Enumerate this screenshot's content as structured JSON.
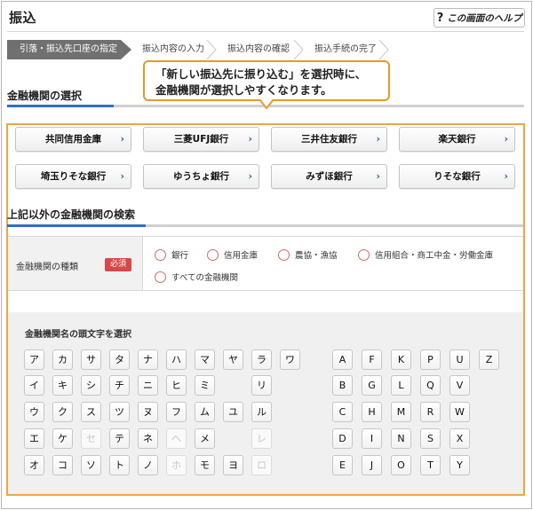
{
  "header": {
    "title": "振込",
    "help_label": "この画面のヘルプ",
    "help_icon": "?"
  },
  "steps": [
    {
      "label": "引落・振込先口座の指定",
      "active": true
    },
    {
      "label": "振込内容の入力",
      "active": false
    },
    {
      "label": "振込内容の確認",
      "active": false
    },
    {
      "label": "振込手続の完了",
      "active": false
    }
  ],
  "tooltip": {
    "line1": "「新しい振込先に振り込む」を選択時に、",
    "line2": "金融機関が選択しやすくなります。"
  },
  "section1": {
    "title": "金融機関の選択"
  },
  "banks": [
    "共同信用金庫",
    "三菱UFJ銀行",
    "三井住友銀行",
    "楽天銀行",
    "埼玉りそな銀行",
    "ゆうちょ銀行",
    "みずほ銀行",
    "りそな銀行"
  ],
  "bank_chevron": "›",
  "section2": {
    "title": "上記以外の金融機関の検索"
  },
  "institution_type": {
    "label": "金融機関の種類",
    "required_badge": "必須",
    "options": [
      "銀行",
      "信用金庫",
      "農協・漁協",
      "信用組合・商工中金・労働金庫",
      "すべての金融機関"
    ]
  },
  "kana_section": {
    "title": "金融機関名の頭文字を選択"
  },
  "kana_columns": [
    [
      "ア",
      "イ",
      "ウ",
      "エ",
      "オ"
    ],
    [
      "カ",
      "キ",
      "ク",
      "ケ",
      "コ"
    ],
    [
      "サ",
      "シ",
      "ス",
      "セ",
      "ソ"
    ],
    [
      "タ",
      "チ",
      "ツ",
      "テ",
      "ト"
    ],
    [
      "ナ",
      "ニ",
      "ヌ",
      "ネ",
      "ノ"
    ],
    [
      "ハ",
      "ヒ",
      "フ",
      "ヘ",
      "ホ"
    ],
    [
      "マ",
      "ミ",
      "ム",
      "メ",
      "モ"
    ],
    [
      "ヤ",
      "",
      "ユ",
      "",
      "ヨ"
    ],
    [
      "ラ",
      "リ",
      "ル",
      "レ",
      "ロ"
    ],
    [
      "ワ",
      "",
      "",
      "",
      ""
    ]
  ],
  "kana_disabled": [
    "セ",
    "ヘ",
    "ホ",
    "レ",
    "ロ"
  ],
  "alpha_columns": [
    [
      "A",
      "B",
      "C",
      "D",
      "E"
    ],
    [
      "F",
      "G",
      "H",
      "I",
      "J"
    ],
    [
      "K",
      "L",
      "M",
      "N",
      "O"
    ],
    [
      "P",
      "Q",
      "R",
      "S",
      "T"
    ],
    [
      "U",
      "V",
      "W",
      "X",
      "Y"
    ],
    [
      "Z",
      "",
      "",
      "",
      ""
    ]
  ],
  "colors": {
    "accent_blue": "#2f6fc5",
    "highlight_orange": "#efa640",
    "required_red": "#d84848",
    "active_step": "#707070"
  }
}
